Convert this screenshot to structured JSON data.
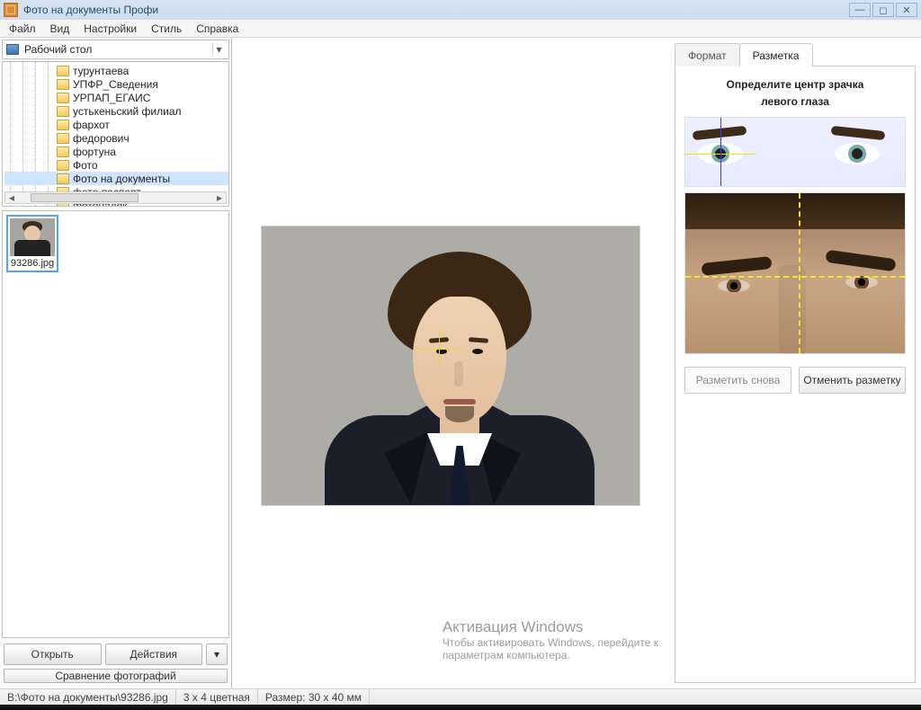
{
  "title": "Фото на документы Профи",
  "menu": {
    "file": "Файл",
    "view": "Вид",
    "settings": "Настройки",
    "style": "Стиль",
    "help": "Справка"
  },
  "path": {
    "label": "Рабочий стол"
  },
  "tree": {
    "items": [
      "турунтаева",
      "УПФР_Сведения",
      "УРПАП_ЕГАИС",
      "устькеньский филиал",
      "фархот",
      "федорович",
      "фортуна",
      "Фото",
      "Фото на документы",
      "фото паспорт",
      "фотонадок"
    ],
    "selectedIndex": 8
  },
  "thumb": {
    "name": "93286.jpg"
  },
  "leftButtons": {
    "open": "Открыть",
    "actions": "Действия",
    "compare": "Сравнение фотографий"
  },
  "rightPanel": {
    "tabs": {
      "format": "Формат",
      "markup": "Разметка"
    },
    "instruction_l1": "Определите центр зрачка",
    "instruction_l2": "левого глаза",
    "retry": "Разметить снова",
    "cancel": "Отменить разметку"
  },
  "watermark": {
    "title": "Активация Windows",
    "line1": "Чтобы активировать Windows, перейдите к",
    "line2": "параметрам компьютера."
  },
  "status": {
    "path": "B:\\Фото на документы\\93286.jpg",
    "mode": "3 x 4 цветная",
    "size": "Размер: 30 x 40 мм"
  }
}
